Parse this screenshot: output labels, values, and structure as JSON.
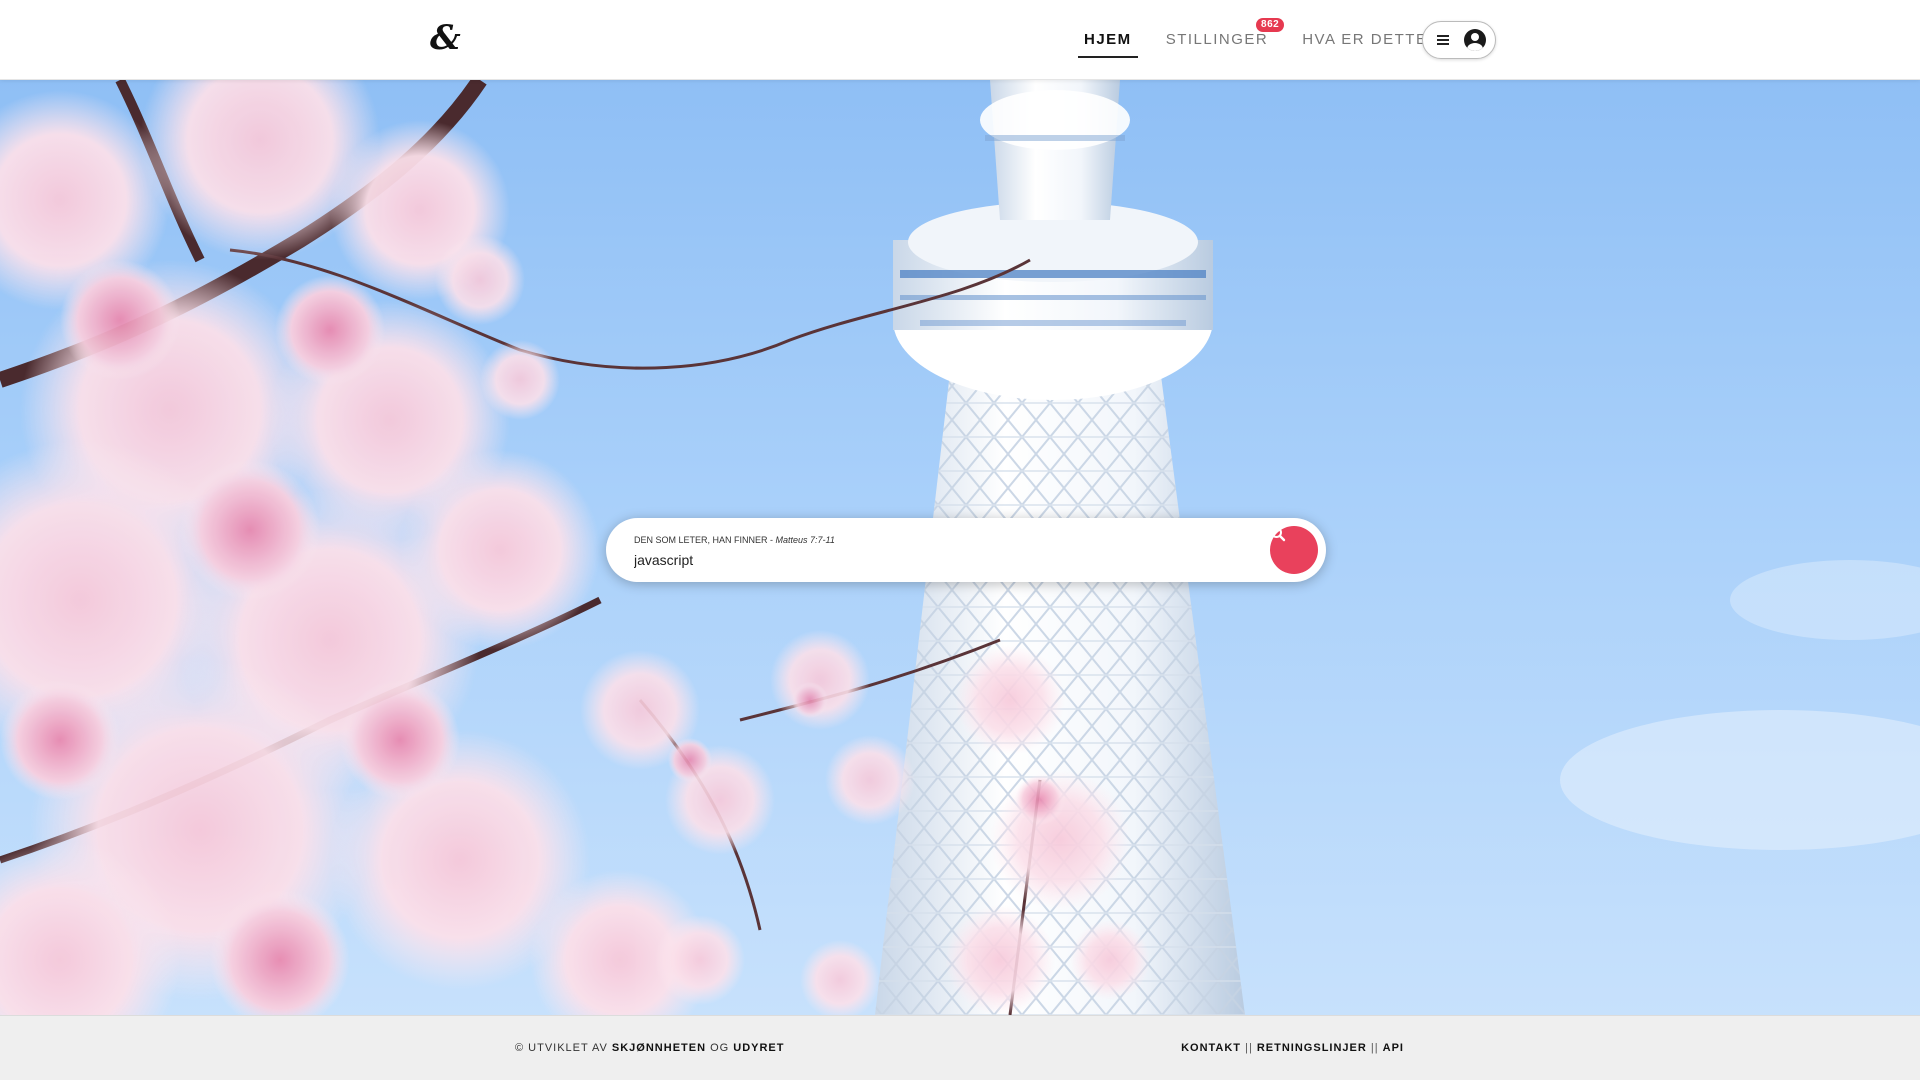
{
  "header": {
    "logo": "&",
    "nav": [
      {
        "label": "HJEM"
      },
      {
        "label": "STILLINGER",
        "badge": "862"
      },
      {
        "label": "HVA ER DETTE?"
      }
    ],
    "menu_icon": "hamburger-icon",
    "user_icon": "user-circle-icon"
  },
  "search": {
    "label_caps": "DEN SOM LETER, HAN FINNER - ",
    "label_ref": "Matteus 7:7-11",
    "value": "javascript",
    "button_icon": "search-icon"
  },
  "footer": {
    "prefix": "© UTVIKLET AV ",
    "name1": "SKJØNNHETEN",
    "conj": " OG ",
    "name2": "UDYRET",
    "links": [
      "KONTAKT",
      "RETNINGSLINJER",
      "API"
    ],
    "separator": " || "
  },
  "colors": {
    "accent": "#e9415c",
    "badge": "#e63950",
    "sky": "#a9d0fa",
    "blossom": "#f6c6d8"
  }
}
